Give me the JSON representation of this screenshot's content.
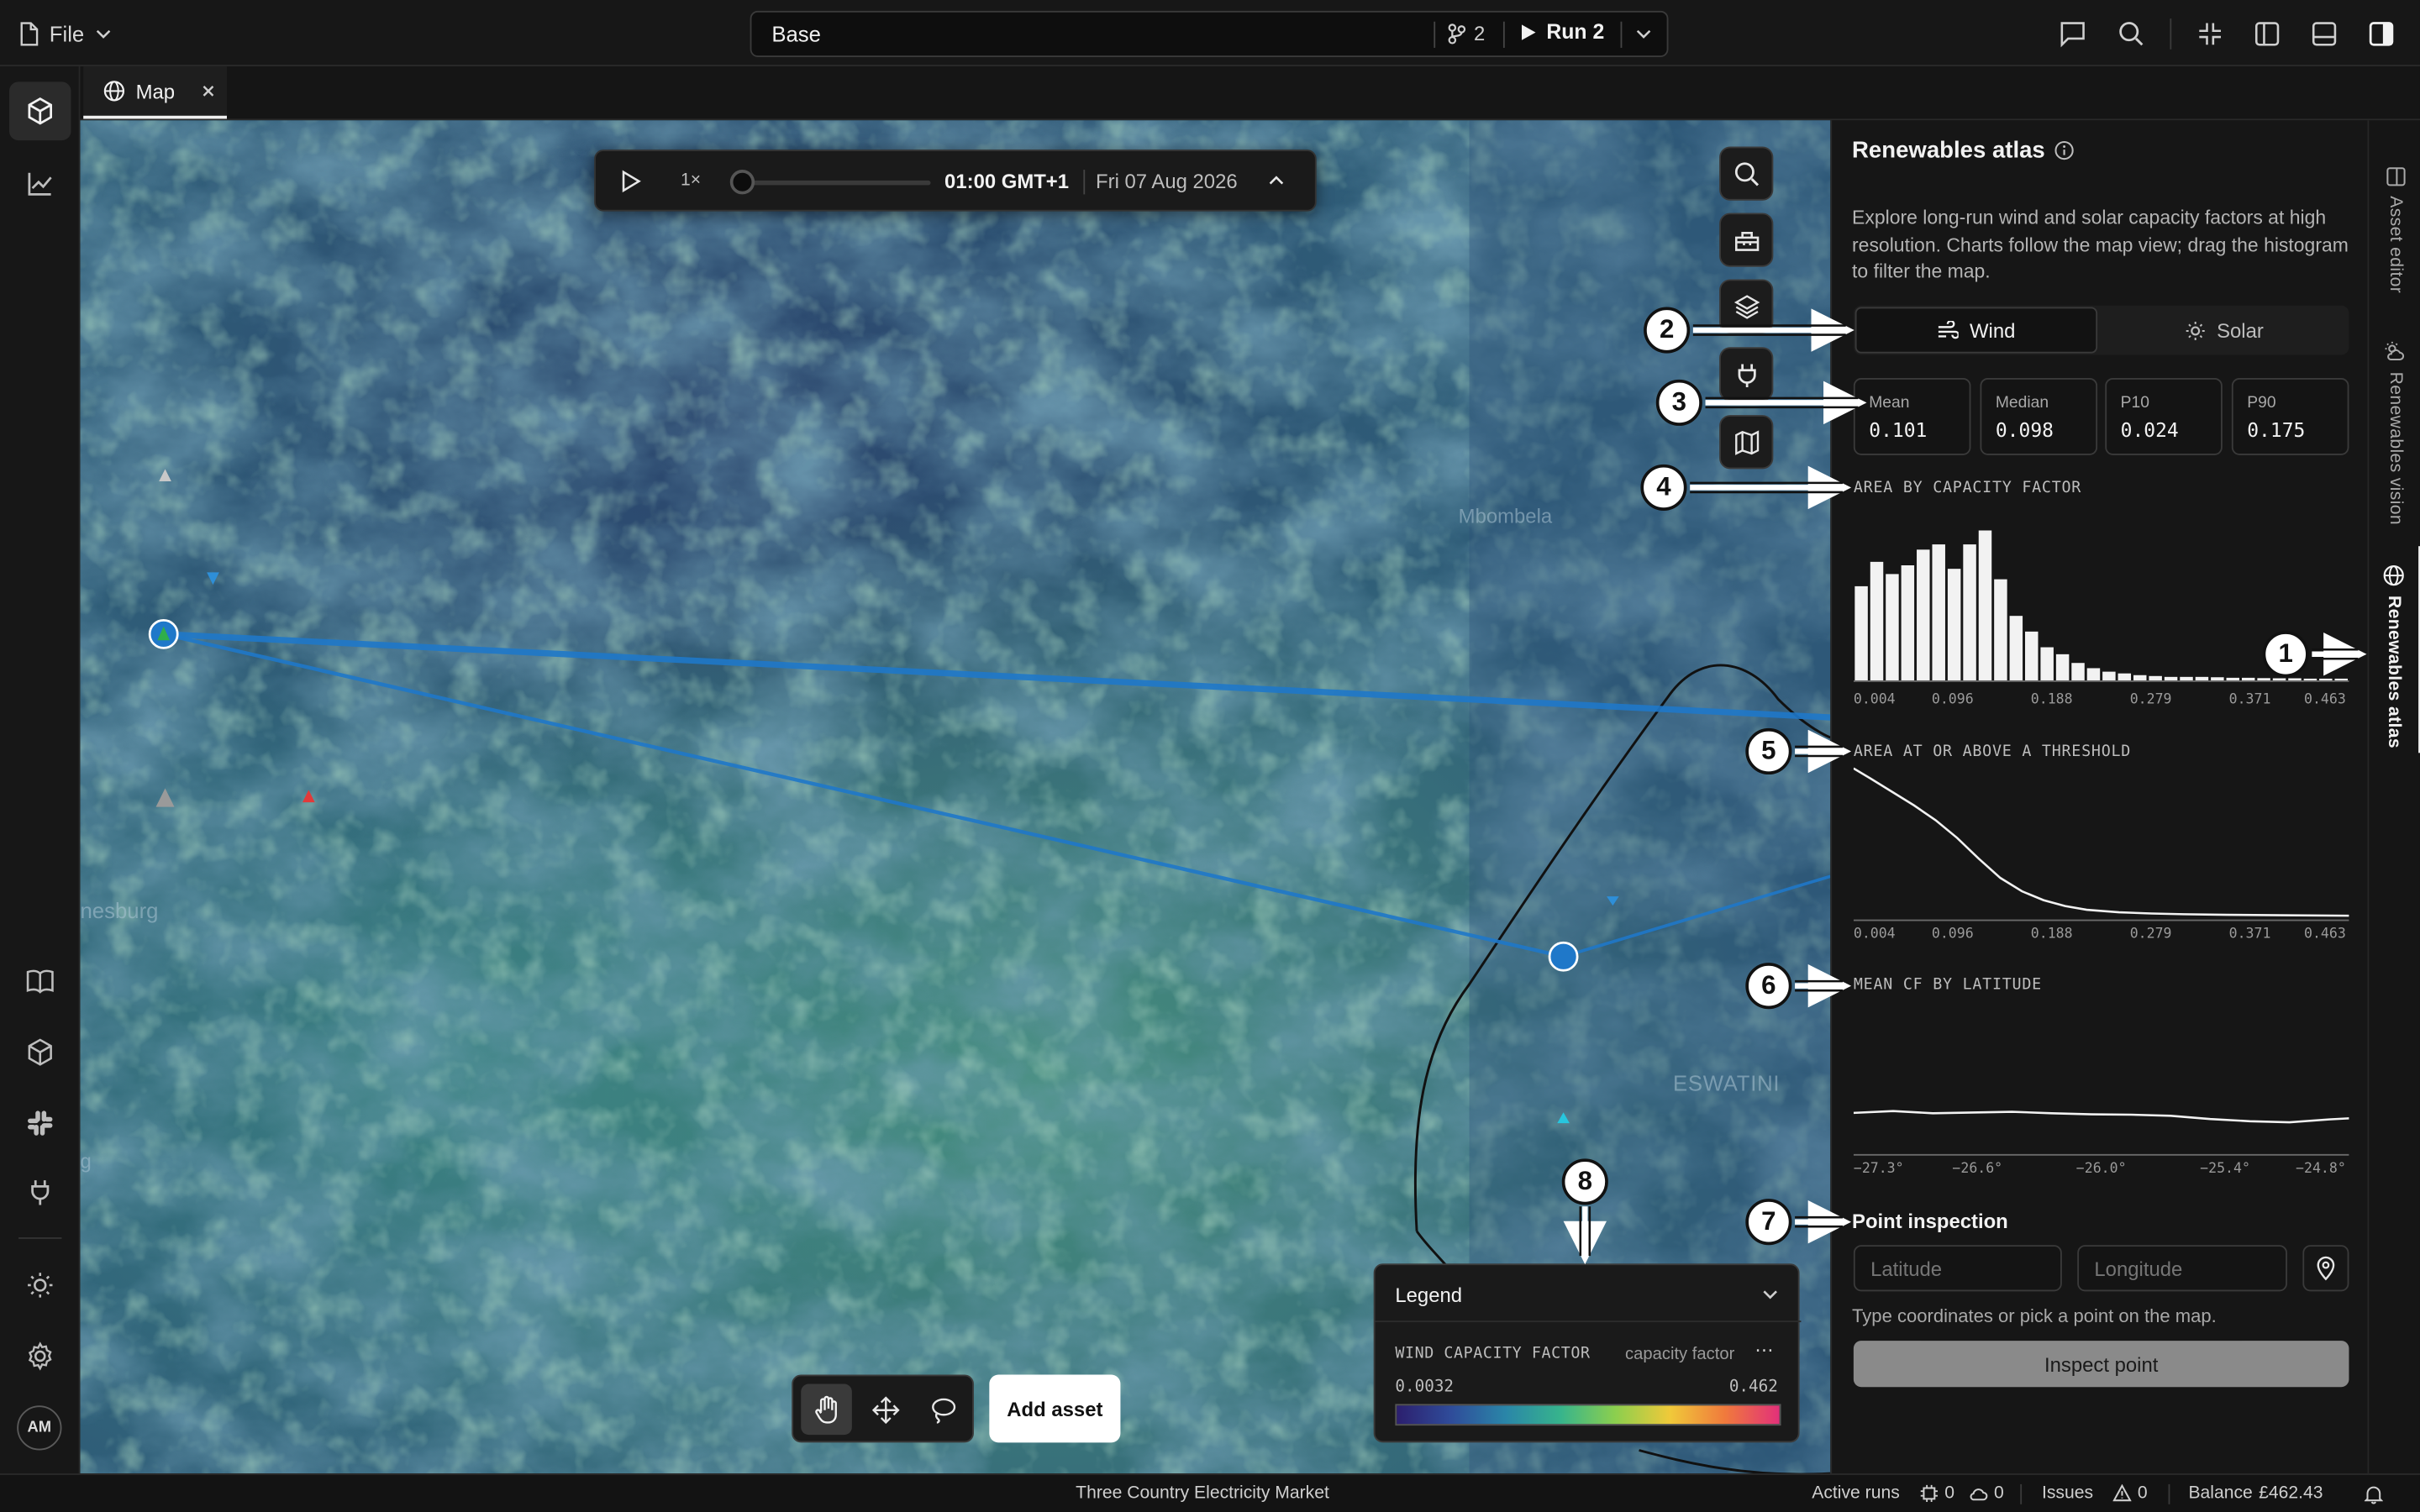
{
  "topbar": {
    "file_label": "File",
    "scenario_name": "Base",
    "branch_count": "2",
    "run_label": "Run 2"
  },
  "tabs": [
    {
      "label": "Map"
    }
  ],
  "map": {
    "labels": [
      "Mbombela",
      "nesburg",
      "ESWATINI",
      "g"
    ],
    "timebar": {
      "speed": "1×",
      "time": "01:00 GMT+1",
      "date": "Fri 07 Aug 2026"
    },
    "tools": [
      "search-icon",
      "toolbox-icon",
      "layers-icon",
      "plug-icon",
      "map-icon"
    ],
    "add_asset_label": "Add asset",
    "legend": {
      "title": "Legend",
      "layer_title": "WIND CAPACITY FACTOR",
      "unit": "capacity factor",
      "min": "0.0032",
      "max": "0.462",
      "gradient": [
        "#2c1f6e",
        "#2f4c9a",
        "#2a86a8",
        "#37b48c",
        "#8ccf4e",
        "#f0c93a",
        "#f07a3c",
        "#e2307a"
      ]
    }
  },
  "panel": {
    "title": "Renewables atlas",
    "description": "Explore long-run wind and solar capacity factors at high resolution. Charts follow the map view; drag the histogram to filter the map.",
    "toggle": {
      "wind": "Wind",
      "solar": "Solar",
      "active": "wind"
    },
    "stats": [
      {
        "label": "Mean",
        "value": "0.101"
      },
      {
        "label": "Median",
        "value": "0.098"
      },
      {
        "label": "P10",
        "value": "0.024"
      },
      {
        "label": "P90",
        "value": "0.175"
      }
    ],
    "point_inspection": {
      "title": "Point inspection",
      "latitude_placeholder": "Latitude",
      "longitude_placeholder": "Longitude",
      "hint": "Type coordinates or pick a point on the map.",
      "button": "Inspect point"
    }
  },
  "chart_data": [
    {
      "type": "bar",
      "title": "AREA BY CAPACITY FACTOR",
      "xticks": [
        "0.004",
        "0.096",
        "0.188",
        "0.279",
        "0.371",
        "0.463"
      ],
      "xlim": [
        0.004,
        0.463
      ],
      "values": [
        0.54,
        0.68,
        0.61,
        0.66,
        0.75,
        0.78,
        0.64,
        0.78,
        0.86,
        0.58,
        0.37,
        0.28,
        0.19,
        0.15,
        0.1,
        0.07,
        0.05,
        0.04,
        0.03,
        0.025,
        0.02,
        0.02,
        0.02,
        0.018,
        0.015,
        0.015,
        0.013,
        0.012,
        0.012,
        0.01,
        0.01,
        0.01
      ]
    },
    {
      "type": "line",
      "title": "AREA AT OR ABOVE A THRESHOLD",
      "xticks": [
        "0.004",
        "0.096",
        "0.188",
        "0.279",
        "0.371",
        "0.463"
      ],
      "xlim": [
        0.004,
        0.463
      ],
      "x": [
        0.004,
        0.02,
        0.04,
        0.06,
        0.08,
        0.1,
        0.12,
        0.14,
        0.16,
        0.18,
        0.2,
        0.22,
        0.25,
        0.28,
        0.31,
        0.35,
        0.4,
        0.463
      ],
      "y": [
        1.0,
        0.93,
        0.84,
        0.75,
        0.65,
        0.53,
        0.39,
        0.26,
        0.17,
        0.11,
        0.07,
        0.045,
        0.028,
        0.02,
        0.015,
        0.011,
        0.008,
        0.005
      ]
    },
    {
      "type": "line",
      "title": "MEAN CF BY LATITUDE",
      "xticks": [
        "−27.3°",
        "−26.6°",
        "−26.0°",
        "−25.4°",
        "−24.8°"
      ],
      "xlim": [
        -27.3,
        -24.8
      ],
      "ylim": [
        0,
        0.4
      ],
      "x": [
        -27.3,
        -27.1,
        -26.9,
        -26.7,
        -26.5,
        -26.3,
        -26.1,
        -25.9,
        -25.7,
        -25.5,
        -25.3,
        -25.1,
        -24.9,
        -24.8
      ],
      "y": [
        0.105,
        0.11,
        0.104,
        0.106,
        0.108,
        0.104,
        0.101,
        0.1,
        0.097,
        0.088,
        0.082,
        0.079,
        0.087,
        0.09
      ]
    }
  ],
  "rightrail": {
    "tabs": [
      {
        "label": "Asset editor"
      },
      {
        "label": "Renewables vision"
      },
      {
        "label": "Renewables atlas"
      }
    ]
  },
  "statusbar": {
    "project": "Three Country Electricity Market",
    "active_runs_label": "Active runs",
    "runs_a": "0",
    "runs_b": "0",
    "issues_label": "Issues",
    "issues_count": "0",
    "balance_label": "Balance",
    "balance_value": "£462.43"
  },
  "callouts": [
    "1",
    "2",
    "3",
    "4",
    "5",
    "6",
    "7",
    "8"
  ]
}
